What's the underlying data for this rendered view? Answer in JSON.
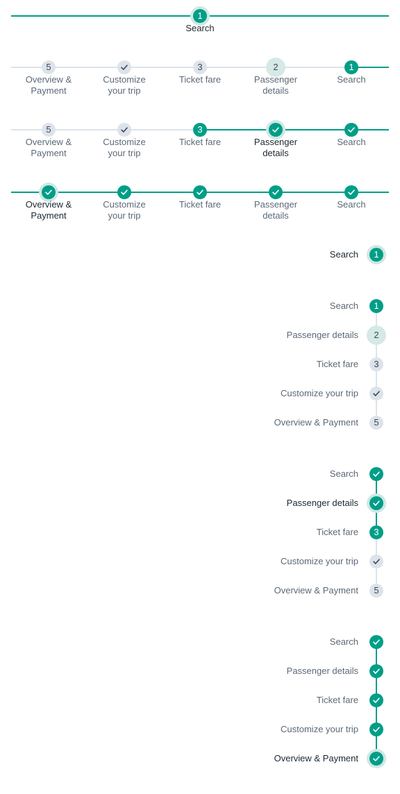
{
  "colors": {
    "teal": "#009e87",
    "idle": "#dde3ea",
    "halo": "#cfe8e3",
    "text": "#5b6978",
    "text_active": "#1d2733"
  },
  "horizontal": [
    {
      "steps": [
        {
          "label": "Search",
          "marker": "1",
          "state": "current"
        }
      ]
    },
    {
      "steps": [
        {
          "label": "Overview & Payment",
          "marker": "5",
          "state": "idle"
        },
        {
          "label": "Customize your trip",
          "marker": "check",
          "state": "idle"
        },
        {
          "label": "Ticket fare",
          "marker": "3",
          "state": "idle"
        },
        {
          "label": "Passenger details",
          "marker": "2",
          "state": "current-idle"
        },
        {
          "label": "Search",
          "marker": "1",
          "state": "done"
        }
      ]
    },
    {
      "steps": [
        {
          "label": "Overview & Payment",
          "marker": "5",
          "state": "idle"
        },
        {
          "label": "Customize your trip",
          "marker": "check",
          "state": "idle"
        },
        {
          "label": "Ticket fare",
          "marker": "3",
          "state": "done"
        },
        {
          "label": "Passenger details",
          "marker": "check",
          "state": "current"
        },
        {
          "label": "Search",
          "marker": "check",
          "state": "done"
        }
      ]
    },
    {
      "steps": [
        {
          "label": "Overview & Payment",
          "marker": "check",
          "state": "current"
        },
        {
          "label": "Customize your trip",
          "marker": "check",
          "state": "done"
        },
        {
          "label": "Ticket fare",
          "marker": "check",
          "state": "done"
        },
        {
          "label": "Passenger details",
          "marker": "check",
          "state": "done"
        },
        {
          "label": "Search",
          "marker": "check",
          "state": "done"
        }
      ]
    }
  ],
  "vertical": [
    {
      "steps": [
        {
          "label": "Search",
          "marker": "1",
          "state": "current"
        }
      ]
    },
    {
      "steps": [
        {
          "label": "Search",
          "marker": "1",
          "state": "done"
        },
        {
          "label": "Passenger details",
          "marker": "2",
          "state": "current-idle"
        },
        {
          "label": "Ticket fare",
          "marker": "3",
          "state": "idle"
        },
        {
          "label": "Customize your trip",
          "marker": "check",
          "state": "idle"
        },
        {
          "label": "Overview & Payment",
          "marker": "5",
          "state": "idle"
        }
      ]
    },
    {
      "steps": [
        {
          "label": "Search",
          "marker": "check",
          "state": "done"
        },
        {
          "label": "Passenger details",
          "marker": "check",
          "state": "current"
        },
        {
          "label": "Ticket fare",
          "marker": "3",
          "state": "done"
        },
        {
          "label": "Customize your trip",
          "marker": "check",
          "state": "idle"
        },
        {
          "label": "Overview & Payment",
          "marker": "5",
          "state": "idle"
        }
      ]
    },
    {
      "steps": [
        {
          "label": "Search",
          "marker": "check",
          "state": "done"
        },
        {
          "label": "Passenger details",
          "marker": "check",
          "state": "done"
        },
        {
          "label": "Ticket fare",
          "marker": "check",
          "state": "done"
        },
        {
          "label": "Customize your trip",
          "marker": "check",
          "state": "done"
        },
        {
          "label": "Overview & Payment",
          "marker": "check",
          "state": "current"
        }
      ]
    }
  ]
}
